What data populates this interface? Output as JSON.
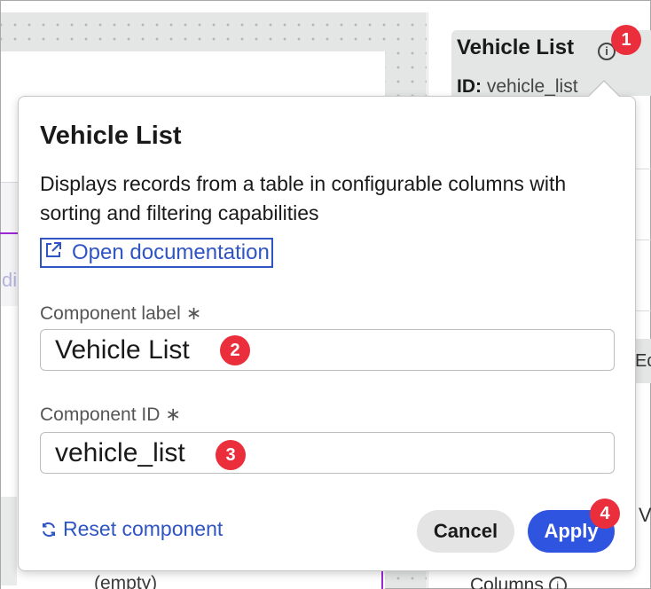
{
  "right_panel": {
    "component_name": "Vehicle List",
    "id_label": "ID:",
    "id_value": "vehicle_list",
    "info_icon": "info-icon",
    "fragment_right": "Ed",
    "fragment_v": "V",
    "columns_label": "Columns"
  },
  "canvas": {
    "ghost_text": "di",
    "empty_text": "(empty)"
  },
  "popover": {
    "title": "Vehicle List",
    "description": "Displays records from a table in configurable columns with sorting and filtering capabilities",
    "doc_link": "Open documentation",
    "fields": {
      "label": {
        "label": "Component label",
        "required_mark": "∗",
        "value": "Vehicle List"
      },
      "id": {
        "label": "Component ID",
        "required_mark": "∗",
        "value": "vehicle_list"
      }
    },
    "reset_label": "Reset component",
    "cancel_label": "Cancel",
    "apply_label": "Apply"
  },
  "badges": [
    "1",
    "2",
    "3",
    "4"
  ],
  "colors": {
    "accent": "#2f54e0",
    "link": "#2f54c4",
    "badge": "#ea2e3c",
    "canvas_bg": "#e4e6e6",
    "selection": "#9b28d4"
  }
}
